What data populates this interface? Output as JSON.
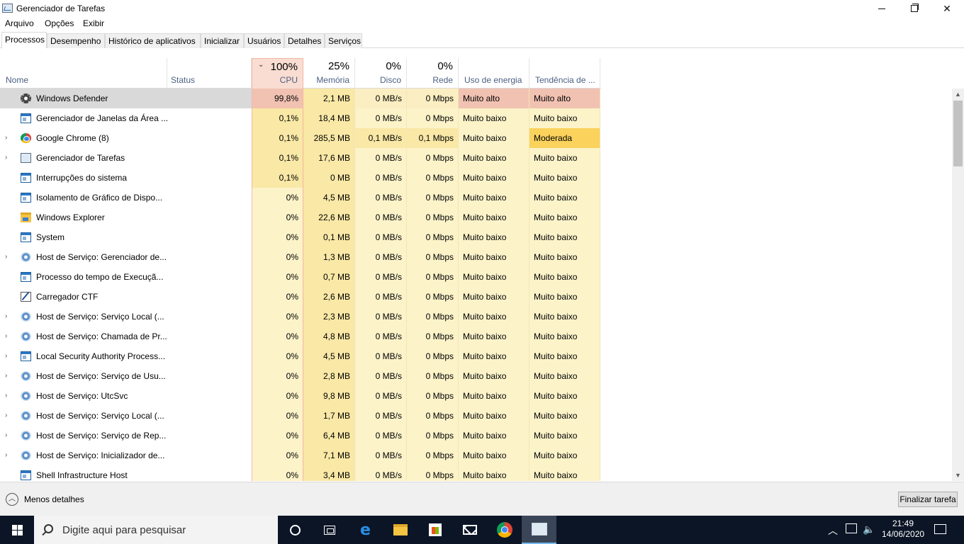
{
  "window": {
    "title": "Gerenciador de Tarefas"
  },
  "menu": [
    "Arquivo",
    "Opções",
    "Exibir"
  ],
  "tabs": [
    "Processos",
    "Desempenho",
    "Histórico de aplicativos",
    "Inicializar",
    "Usuários",
    "Detalhes",
    "Serviços"
  ],
  "columns": {
    "name": "Nome",
    "status": "Status",
    "cpu": {
      "pct": "100%",
      "label": "CPU"
    },
    "memory": {
      "pct": "25%",
      "label": "Memória"
    },
    "disk": {
      "pct": "0%",
      "label": "Disco"
    },
    "network": {
      "pct": "0%",
      "label": "Rede"
    },
    "power": "Uso de energia",
    "trend": "Tendência de ..."
  },
  "colors": {
    "high": "#f1c2b2",
    "cpu_active": "#f9e8a6",
    "light": "#fcf3c9",
    "moderate": "#fad25c"
  },
  "processes": [
    {
      "name": "Windows Defender",
      "icon": "gear-dark-icon",
      "expand": false,
      "cpu": "99,8%",
      "mem": "2,1 MB",
      "disk": "0 MB/s",
      "net": "0 Mbps",
      "power": "Muito alto",
      "trend": "Muito alto",
      "selected": true
    },
    {
      "name": "Gerenciador de Janelas da Área ...",
      "icon": "window-icon",
      "expand": false,
      "cpu": "0,1%",
      "mem": "18,4 MB",
      "disk": "0 MB/s",
      "net": "0 Mbps",
      "power": "Muito baixo",
      "trend": "Muito baixo"
    },
    {
      "name": "Google Chrome (8)",
      "icon": "chrome-icon",
      "expand": true,
      "cpu": "0,1%",
      "mem": "285,5 MB",
      "disk": "0,1 MB/s",
      "net": "0,1 Mbps",
      "power": "Muito baixo",
      "trend": "Moderada"
    },
    {
      "name": "Gerenciador de Tarefas",
      "icon": "task-manager-icon",
      "expand": true,
      "cpu": "0,1%",
      "mem": "17,6 MB",
      "disk": "0 MB/s",
      "net": "0 Mbps",
      "power": "Muito baixo",
      "trend": "Muito baixo"
    },
    {
      "name": "Interrupções do sistema",
      "icon": "window-icon",
      "expand": false,
      "cpu": "0,1%",
      "mem": "0 MB",
      "disk": "0 MB/s",
      "net": "0 Mbps",
      "power": "Muito baixo",
      "trend": "Muito baixo"
    },
    {
      "name": "Isolamento de Gráfico de Dispo...",
      "icon": "window-icon",
      "expand": false,
      "cpu": "0%",
      "mem": "4,5 MB",
      "disk": "0 MB/s",
      "net": "0 Mbps",
      "power": "Muito baixo",
      "trend": "Muito baixo"
    },
    {
      "name": "Windows Explorer",
      "icon": "folder-icon",
      "expand": false,
      "cpu": "0%",
      "mem": "22,6 MB",
      "disk": "0 MB/s",
      "net": "0 Mbps",
      "power": "Muito baixo",
      "trend": "Muito baixo"
    },
    {
      "name": "System",
      "icon": "window-icon",
      "expand": false,
      "cpu": "0%",
      "mem": "0,1 MB",
      "disk": "0 MB/s",
      "net": "0 Mbps",
      "power": "Muito baixo",
      "trend": "Muito baixo"
    },
    {
      "name": "Host de Serviço: Gerenciador de...",
      "icon": "gear-icon",
      "expand": true,
      "cpu": "0%",
      "mem": "1,3 MB",
      "disk": "0 MB/s",
      "net": "0 Mbps",
      "power": "Muito baixo",
      "trend": "Muito baixo"
    },
    {
      "name": "Processo do tempo de Execuçã...",
      "icon": "window-icon",
      "expand": false,
      "cpu": "0%",
      "mem": "0,7 MB",
      "disk": "0 MB/s",
      "net": "0 Mbps",
      "power": "Muito baixo",
      "trend": "Muito baixo"
    },
    {
      "name": "Carregador CTF",
      "icon": "ctf-icon",
      "expand": false,
      "cpu": "0%",
      "mem": "2,6 MB",
      "disk": "0 MB/s",
      "net": "0 Mbps",
      "power": "Muito baixo",
      "trend": "Muito baixo"
    },
    {
      "name": "Host de Serviço: Serviço Local (...",
      "icon": "gear-icon",
      "expand": true,
      "cpu": "0%",
      "mem": "2,3 MB",
      "disk": "0 MB/s",
      "net": "0 Mbps",
      "power": "Muito baixo",
      "trend": "Muito baixo"
    },
    {
      "name": "Host de Serviço: Chamada de Pr...",
      "icon": "gear-icon",
      "expand": true,
      "cpu": "0%",
      "mem": "4,8 MB",
      "disk": "0 MB/s",
      "net": "0 Mbps",
      "power": "Muito baixo",
      "trend": "Muito baixo"
    },
    {
      "name": "Local Security Authority Process...",
      "icon": "window-icon",
      "expand": true,
      "cpu": "0%",
      "mem": "4,5 MB",
      "disk": "0 MB/s",
      "net": "0 Mbps",
      "power": "Muito baixo",
      "trend": "Muito baixo"
    },
    {
      "name": "Host de Serviço: Serviço de Usu...",
      "icon": "gear-icon",
      "expand": true,
      "cpu": "0%",
      "mem": "2,8 MB",
      "disk": "0 MB/s",
      "net": "0 Mbps",
      "power": "Muito baixo",
      "trend": "Muito baixo"
    },
    {
      "name": "Host de Serviço: UtcSvc",
      "icon": "gear-icon",
      "expand": true,
      "cpu": "0%",
      "mem": "9,8 MB",
      "disk": "0 MB/s",
      "net": "0 Mbps",
      "power": "Muito baixo",
      "trend": "Muito baixo"
    },
    {
      "name": "Host de Serviço: Serviço Local (...",
      "icon": "gear-icon",
      "expand": true,
      "cpu": "0%",
      "mem": "1,7 MB",
      "disk": "0 MB/s",
      "net": "0 Mbps",
      "power": "Muito baixo",
      "trend": "Muito baixo"
    },
    {
      "name": "Host de Serviço: Serviço de Rep...",
      "icon": "gear-icon",
      "expand": true,
      "cpu": "0%",
      "mem": "6,4 MB",
      "disk": "0 MB/s",
      "net": "0 Mbps",
      "power": "Muito baixo",
      "trend": "Muito baixo"
    },
    {
      "name": "Host de Serviço: Inicializador de...",
      "icon": "gear-icon",
      "expand": true,
      "cpu": "0%",
      "mem": "7,1 MB",
      "disk": "0 MB/s",
      "net": "0 Mbps",
      "power": "Muito baixo",
      "trend": "Muito baixo"
    },
    {
      "name": "Shell Infrastructure Host",
      "icon": "window-icon",
      "expand": false,
      "cpu": "0%",
      "mem": "3,4 MB",
      "disk": "0 MB/s",
      "net": "0 Mbps",
      "power": "Muito baixo",
      "trend": "Muito baixo"
    }
  ],
  "footer": {
    "less_details": "Menos detalhes",
    "end_task": "Finalizar tarefa"
  },
  "taskbar": {
    "search_placeholder": "Digite aqui para pesquisar",
    "time": "21:49",
    "date": "14/06/2020"
  }
}
